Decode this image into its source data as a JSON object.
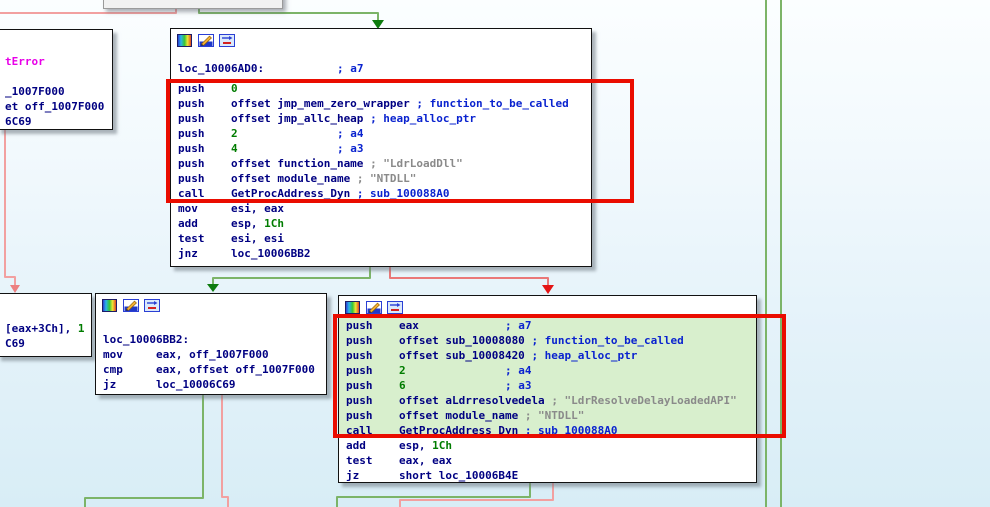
{
  "colors": {
    "edge_green": "#7cb468",
    "arrow_green": "#0e7c0e",
    "edge_pink": "#f2a0a0",
    "edge_red": "#ea7878",
    "arrow_red": "#e41414",
    "arrow_pink": "#ec8080",
    "highlight_border": "#ea0c00",
    "selection_background": "#d8efcd",
    "node_background": "#ffffff",
    "code_text": "#000082",
    "number_text": "#007c00",
    "comment_text": "#0a23cf",
    "string_text": "#8a8a8a",
    "import_text": "#e800e8"
  },
  "node_toolbar_icons": [
    "node-color-icon",
    "edit-node-icon",
    "group-node-icon"
  ],
  "blocks": {
    "top_partial": {
      "lines": [
        {
          "seg": [
            {
              "t": "tError",
              "k": "i"
            }
          ]
        },
        {
          "seg": [
            {
              "t": " ",
              "k": "c"
            }
          ]
        },
        {
          "seg": [
            {
              "t": "_1007F000",
              "k": "c"
            }
          ]
        },
        {
          "seg": [
            {
              "t": "et off_1007F000",
              "k": "c"
            }
          ]
        },
        {
          "seg": [
            {
              "t": "6C69",
              "k": "c"
            }
          ]
        }
      ]
    },
    "main_top": {
      "lines": [
        {
          "h": 20,
          "seg": [
            {
              "t": "loc_10006AD0:",
              "k": "c"
            },
            {
              "t": "           ",
              "k": "c"
            },
            {
              "t": "; a7",
              "k": "m"
            }
          ]
        },
        {
          "seg": [
            {
              "t": "push    ",
              "k": "c"
            },
            {
              "t": "0",
              "k": "n"
            }
          ]
        },
        {
          "seg": [
            {
              "t": "push    offset jmp_mem_zero_wrapper ",
              "k": "c"
            },
            {
              "t": "; function_to_be_called",
              "k": "m"
            }
          ]
        },
        {
          "seg": [
            {
              "t": "push    offset jmp_allc_heap ",
              "k": "c"
            },
            {
              "t": "; heap_alloc_ptr",
              "k": "m"
            }
          ]
        },
        {
          "seg": [
            {
              "t": "push    ",
              "k": "c"
            },
            {
              "t": "2",
              "k": "n"
            },
            {
              "t": "               ",
              "k": "c"
            },
            {
              "t": "; a4",
              "k": "m"
            }
          ]
        },
        {
          "seg": [
            {
              "t": "push    ",
              "k": "c"
            },
            {
              "t": "4",
              "k": "n"
            },
            {
              "t": "               ",
              "k": "c"
            },
            {
              "t": "; a3",
              "k": "m"
            }
          ]
        },
        {
          "seg": [
            {
              "t": "push    offset function_name ",
              "k": "c"
            },
            {
              "t": "; \"LdrLoadDll\"",
              "k": "s"
            }
          ]
        },
        {
          "seg": [
            {
              "t": "push    offset module_name ",
              "k": "c"
            },
            {
              "t": "; \"NTDLL\"",
              "k": "s"
            }
          ]
        },
        {
          "seg": [
            {
              "t": "call    GetProcAddress_Dyn ",
              "k": "c"
            },
            {
              "t": "; sub_100088A0",
              "k": "m"
            }
          ]
        },
        {
          "seg": [
            {
              "t": "mov     esi, eax",
              "k": "c"
            }
          ]
        },
        {
          "seg": [
            {
              "t": "add     esp, ",
              "k": "c"
            },
            {
              "t": "1Ch",
              "k": "n"
            }
          ]
        },
        {
          "seg": [
            {
              "t": "test    esi, esi",
              "k": "c"
            }
          ]
        },
        {
          "seg": [
            {
              "t": "jnz     loc_10006BB2",
              "k": "c"
            }
          ]
        }
      ]
    },
    "left_partial": {
      "lines": [
        {
          "seg": [
            {
              "t": "[eax+3Ch], ",
              "k": "c"
            },
            {
              "t": "1",
              "k": "n"
            }
          ]
        },
        {
          "seg": [
            {
              "t": "C69",
              "k": "c"
            }
          ]
        }
      ]
    },
    "bb2": {
      "lines": [
        {
          "seg": [
            {
              "t": "loc_10006BB2:",
              "k": "c"
            }
          ]
        },
        {
          "seg": [
            {
              "t": "mov     eax, off_1007F000",
              "k": "c"
            }
          ]
        },
        {
          "seg": [
            {
              "t": "cmp     eax, offset off_1007F000",
              "k": "c"
            }
          ]
        },
        {
          "seg": [
            {
              "t": "jz      loc_10006C69",
              "k": "c"
            }
          ]
        }
      ]
    },
    "delay_resolve": {
      "lines": [
        {
          "hl": true,
          "seg": [
            {
              "t": "push    eax",
              "k": "c"
            },
            {
              "t": "             ",
              "k": "c"
            },
            {
              "t": "; a7",
              "k": "m"
            }
          ]
        },
        {
          "hl": true,
          "seg": [
            {
              "t": "push    offset sub_10008080 ",
              "k": "c"
            },
            {
              "t": "; function_to_be_called",
              "k": "m"
            }
          ]
        },
        {
          "hl": true,
          "seg": [
            {
              "t": "push    offset sub_10008420 ",
              "k": "c"
            },
            {
              "t": "; heap_alloc_ptr",
              "k": "m"
            }
          ]
        },
        {
          "hl": true,
          "seg": [
            {
              "t": "push    ",
              "k": "c"
            },
            {
              "t": "2",
              "k": "n"
            },
            {
              "t": "               ",
              "k": "c"
            },
            {
              "t": "; a4",
              "k": "m"
            }
          ]
        },
        {
          "hl": true,
          "seg": [
            {
              "t": "push    ",
              "k": "c"
            },
            {
              "t": "6",
              "k": "n"
            },
            {
              "t": "               ",
              "k": "c"
            },
            {
              "t": "; a3",
              "k": "m"
            }
          ]
        },
        {
          "hl": true,
          "seg": [
            {
              "t": "push    offset aLdrresolvedela ",
              "k": "c"
            },
            {
              "t": "; \"LdrResolveDelayLoadedAPI\"",
              "k": "s"
            }
          ]
        },
        {
          "hl": true,
          "seg": [
            {
              "t": "push    offset module_name ",
              "k": "c"
            },
            {
              "t": "; \"NTDLL\"",
              "k": "s"
            }
          ]
        },
        {
          "hl": true,
          "seg": [
            {
              "t": "call    GetProcAddress_Dyn ",
              "k": "c"
            },
            {
              "t": "; sub_100088A0",
              "k": "m"
            }
          ]
        },
        {
          "seg": [
            {
              "t": "add     esp, ",
              "k": "c"
            },
            {
              "t": "1Ch",
              "k": "n"
            }
          ]
        },
        {
          "seg": [
            {
              "t": "test    eax, eax",
              "k": "c"
            }
          ]
        },
        {
          "seg": [
            {
              "t": "jz      short loc_10006B4E",
              "k": "c"
            }
          ]
        }
      ]
    }
  }
}
